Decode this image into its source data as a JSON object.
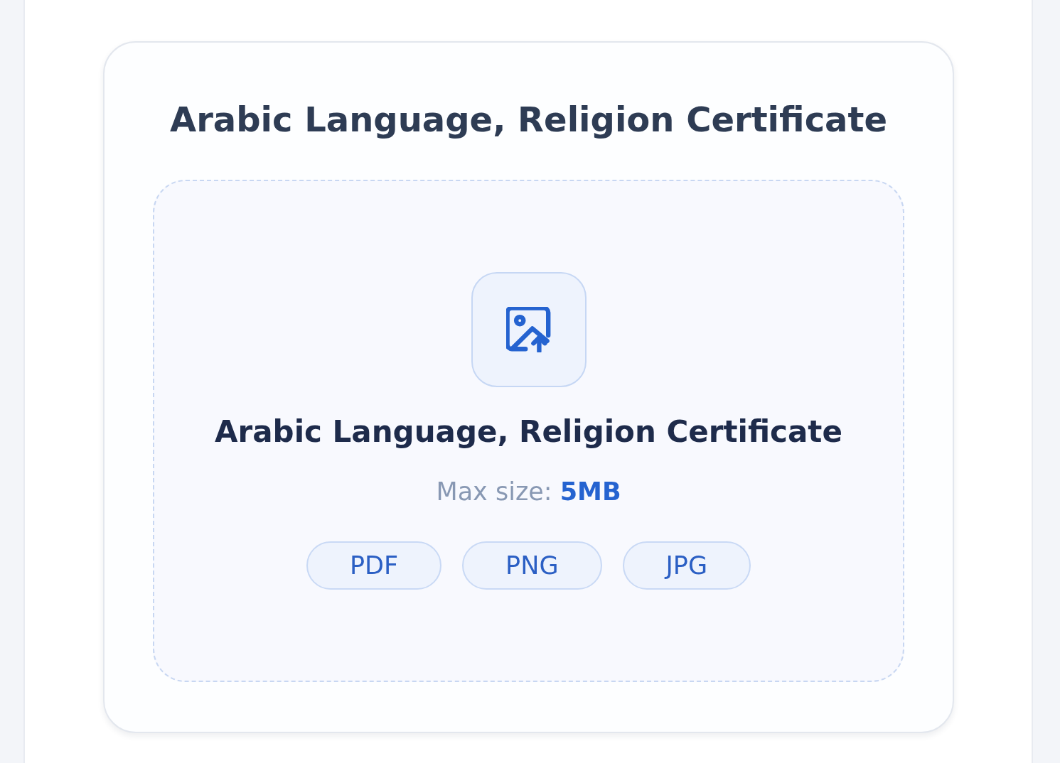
{
  "card": {
    "title": "Arabic Language, Religion Certificate",
    "upload": {
      "label": "Arabic Language, Religion Certificate",
      "max_size": "Max size: **5MB**",
      "formats": [
        "PDF",
        "PNG",
        "JPG"
      ]
    }
  }
}
